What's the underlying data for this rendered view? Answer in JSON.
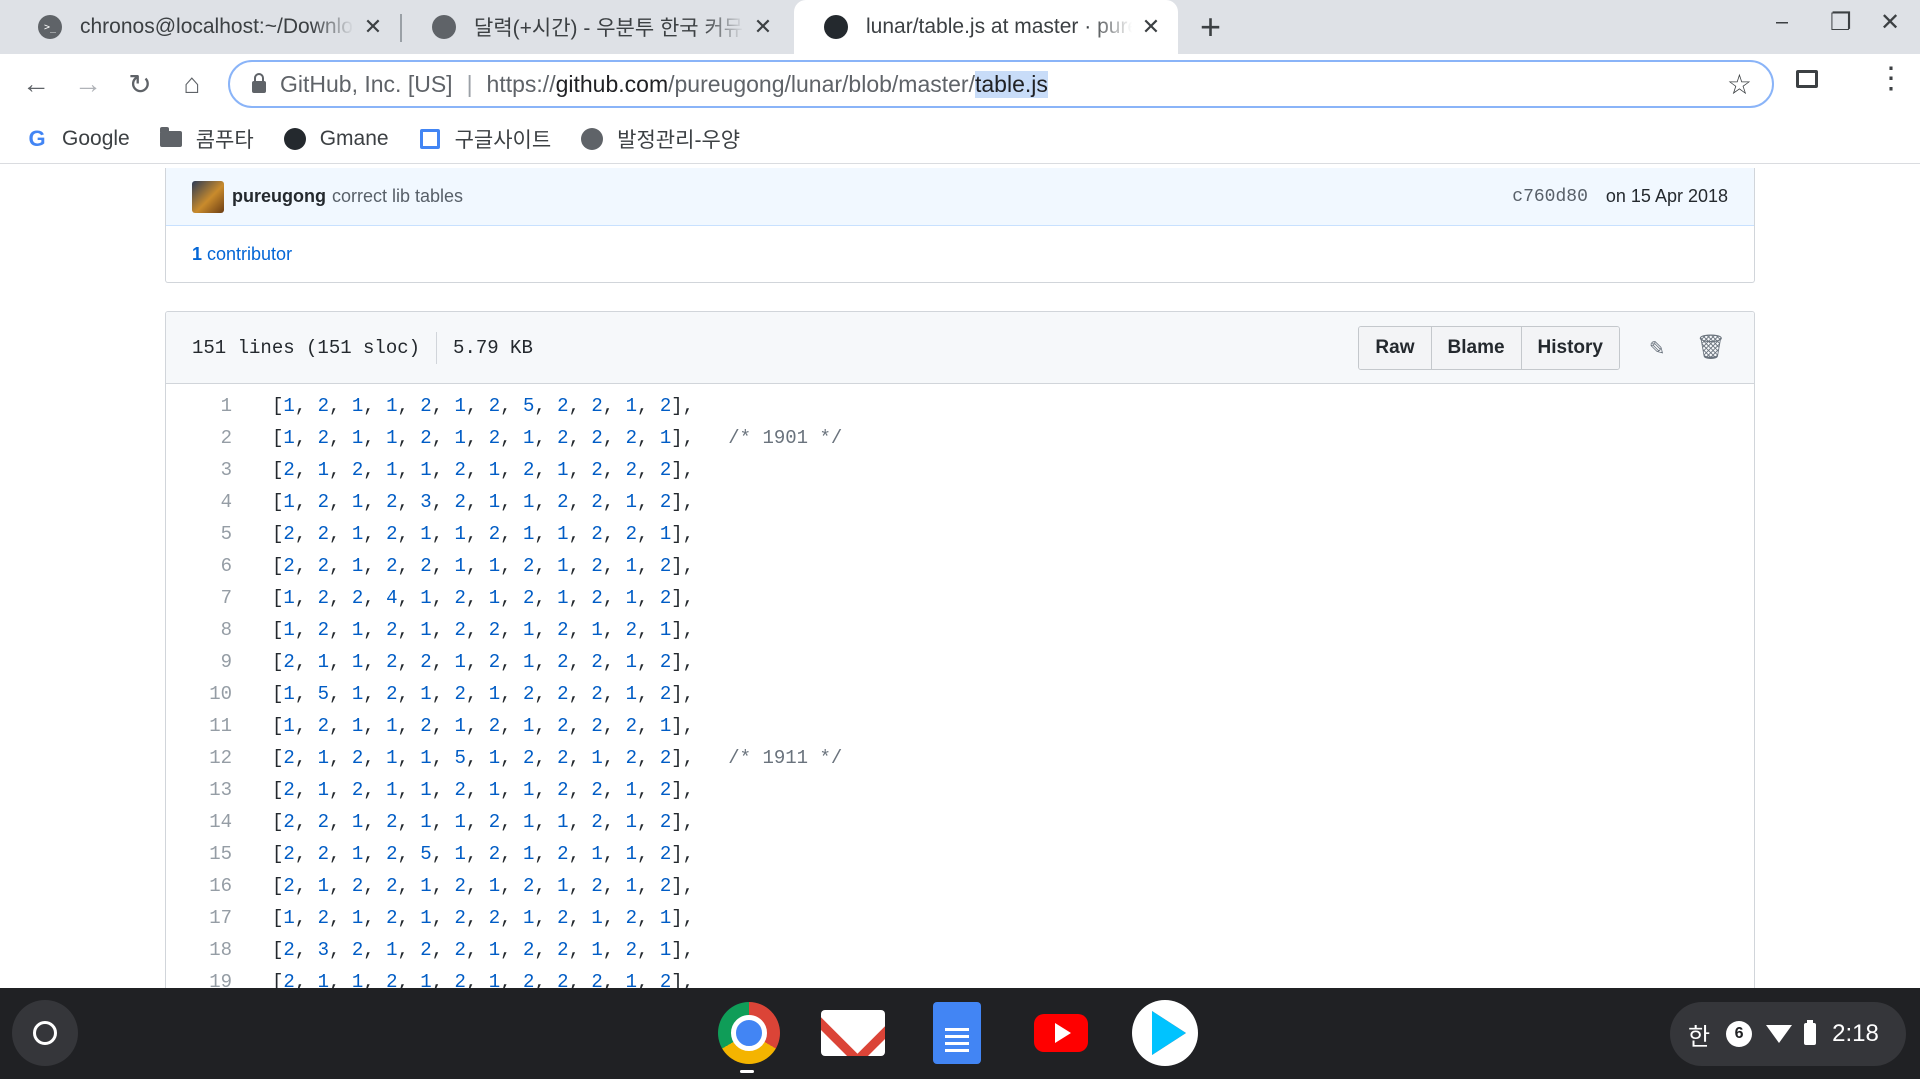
{
  "browser": {
    "tabs": [
      {
        "title": "chronos@localhost:~/Downloads",
        "active": false,
        "icon": "terminal-icon"
      },
      {
        "title": "달력(+시간) - 우분투 한국 커뮤니티",
        "active": false,
        "icon": "globe-icon"
      },
      {
        "title": "lunar/table.js at master · pureugong/lunar",
        "active": true,
        "icon": "github-icon"
      }
    ],
    "omnibox": {
      "site_identity": "GitHub, Inc. [US]",
      "separator": "|",
      "url_scheme": "https://",
      "url_host": "github.com",
      "url_path": "/pureugong/lunar/blob/master/",
      "url_selected": "table.js"
    },
    "bookmarks": [
      {
        "label": "Google",
        "icon": "google-icon"
      },
      {
        "label": "콤푸타",
        "icon": "folder-icon"
      },
      {
        "label": "Gmane",
        "icon": "github-icon"
      },
      {
        "label": "구글사이트",
        "icon": "sites-icon"
      },
      {
        "label": "발정관리-우양",
        "icon": "globe-icon"
      }
    ]
  },
  "commit": {
    "author": "pureugong",
    "message": "correct lib tables",
    "sha": "c760d80",
    "date": "on 15 Apr 2018",
    "contributors_count": "1",
    "contributors_label": "contributor"
  },
  "file": {
    "lines_info": "151 lines (151 sloc)",
    "size": "5.79 KB",
    "buttons": {
      "raw": "Raw",
      "blame": "Blame",
      "history": "History"
    },
    "code_lines": [
      {
        "n": "1",
        "values": [
          1,
          2,
          1,
          1,
          2,
          1,
          2,
          5,
          2,
          2,
          1,
          2
        ],
        "comment": ""
      },
      {
        "n": "2",
        "values": [
          1,
          2,
          1,
          1,
          2,
          1,
          2,
          1,
          2,
          2,
          2,
          1
        ],
        "comment": "/* 1901 */"
      },
      {
        "n": "3",
        "values": [
          2,
          1,
          2,
          1,
          1,
          2,
          1,
          2,
          1,
          2,
          2,
          2
        ],
        "comment": ""
      },
      {
        "n": "4",
        "values": [
          1,
          2,
          1,
          2,
          3,
          2,
          1,
          1,
          2,
          2,
          1,
          2
        ],
        "comment": ""
      },
      {
        "n": "5",
        "values": [
          2,
          2,
          1,
          2,
          1,
          1,
          2,
          1,
          1,
          2,
          2,
          1
        ],
        "comment": ""
      },
      {
        "n": "6",
        "values": [
          2,
          2,
          1,
          2,
          2,
          1,
          1,
          2,
          1,
          2,
          1,
          2
        ],
        "comment": ""
      },
      {
        "n": "7",
        "values": [
          1,
          2,
          2,
          4,
          1,
          2,
          1,
          2,
          1,
          2,
          1,
          2
        ],
        "comment": ""
      },
      {
        "n": "8",
        "values": [
          1,
          2,
          1,
          2,
          1,
          2,
          2,
          1,
          2,
          1,
          2,
          1
        ],
        "comment": ""
      },
      {
        "n": "9",
        "values": [
          2,
          1,
          1,
          2,
          2,
          1,
          2,
          1,
          2,
          2,
          1,
          2
        ],
        "comment": ""
      },
      {
        "n": "10",
        "values": [
          1,
          5,
          1,
          2,
          1,
          2,
          1,
          2,
          2,
          2,
          1,
          2
        ],
        "comment": ""
      },
      {
        "n": "11",
        "values": [
          1,
          2,
          1,
          1,
          2,
          1,
          2,
          1,
          2,
          2,
          2,
          1
        ],
        "comment": ""
      },
      {
        "n": "12",
        "values": [
          2,
          1,
          2,
          1,
          1,
          5,
          1,
          2,
          2,
          1,
          2,
          2
        ],
        "comment": "/* 1911 */"
      },
      {
        "n": "13",
        "values": [
          2,
          1,
          2,
          1,
          1,
          2,
          1,
          1,
          2,
          2,
          1,
          2
        ],
        "comment": ""
      },
      {
        "n": "14",
        "values": [
          2,
          2,
          1,
          2,
          1,
          1,
          2,
          1,
          1,
          2,
          1,
          2
        ],
        "comment": ""
      },
      {
        "n": "15",
        "values": [
          2,
          2,
          1,
          2,
          5,
          1,
          2,
          1,
          2,
          1,
          1,
          2
        ],
        "comment": ""
      },
      {
        "n": "16",
        "values": [
          2,
          1,
          2,
          2,
          1,
          2,
          1,
          2,
          1,
          2,
          1,
          2
        ],
        "comment": ""
      },
      {
        "n": "17",
        "values": [
          1,
          2,
          1,
          2,
          1,
          2,
          2,
          1,
          2,
          1,
          2,
          1
        ],
        "comment": ""
      },
      {
        "n": "18",
        "values": [
          2,
          3,
          2,
          1,
          2,
          2,
          1,
          2,
          2,
          1,
          2,
          1
        ],
        "comment": ""
      },
      {
        "n": "19",
        "values": [
          2,
          1,
          1,
          2,
          1,
          2,
          1,
          2,
          2,
          2,
          1,
          2
        ],
        "comment": ""
      }
    ]
  },
  "shelf": {
    "apps": [
      {
        "name": "Chrome",
        "icon": "chrome-icon"
      },
      {
        "name": "Gmail",
        "icon": "gmail-icon"
      },
      {
        "name": "Docs",
        "icon": "docs-icon"
      },
      {
        "name": "YouTube",
        "icon": "youtube-icon"
      },
      {
        "name": "Play Store",
        "icon": "play-store-icon"
      }
    ],
    "tray": {
      "ime": "한",
      "notification_count": "6",
      "time": "2:18"
    }
  }
}
